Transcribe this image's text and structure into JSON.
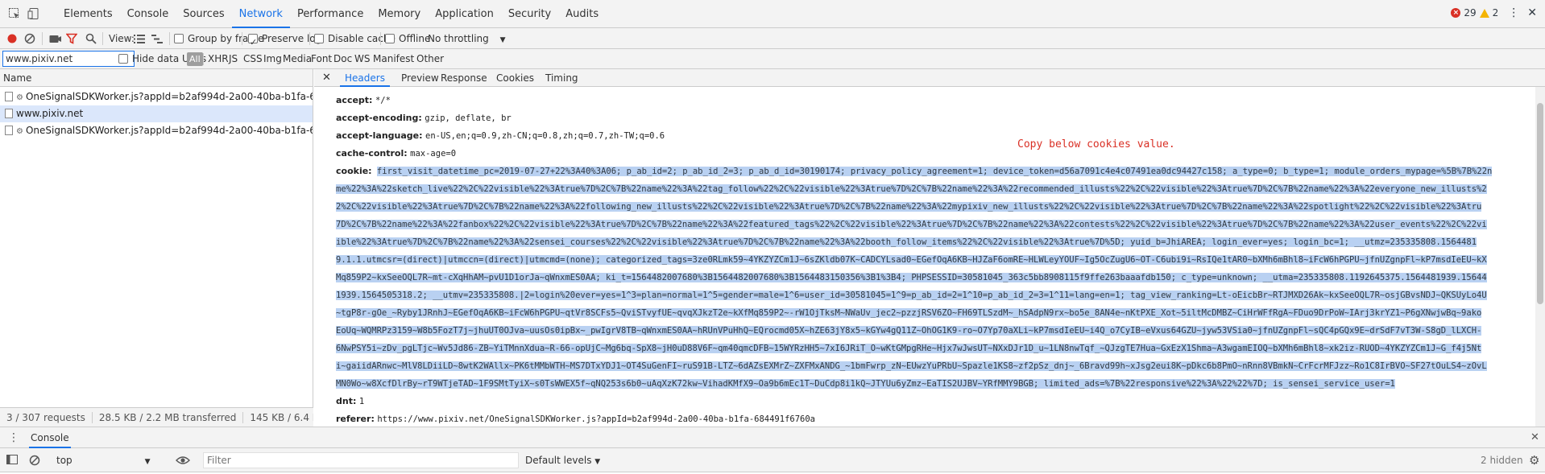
{
  "top_tabs": [
    "Elements",
    "Console",
    "Sources",
    "Network",
    "Performance",
    "Memory",
    "Application",
    "Security",
    "Audits"
  ],
  "active_top_tab": "Network",
  "issues": {
    "errors": "29",
    "warnings": "2"
  },
  "toolbar": {
    "view_label": "View:",
    "group_by_frame": "Group by frame",
    "preserve_log": "Preserve log",
    "disable_cache": "Disable cache",
    "offline": "Offline",
    "throttling": "No throttling"
  },
  "filter_bar": {
    "filter_value": "www.pixiv.net",
    "hide_data_urls": "Hide data URLs",
    "types": [
      "All",
      "XHR",
      "JS",
      "CSS",
      "Img",
      "Media",
      "Font",
      "Doc",
      "WS",
      "Manifest",
      "Other"
    ]
  },
  "request_list": {
    "header": "Name",
    "rows": [
      "OneSignalSDKWorker.js?appId=b2af994d-2a00-40ba-b1fa-6844...",
      "www.pixiv.net",
      "OneSignalSDKWorker.js?appId=b2af994d-2a00-40ba-b1fa-6844..."
    ],
    "status": [
      "3 / 307 requests",
      "28.5 KB / 2.2 MB transferred",
      "145 KB / 6.4 MB resc"
    ]
  },
  "detail_tabs": [
    "Headers",
    "Preview",
    "Response",
    "Cookies",
    "Timing"
  ],
  "active_detail_tab": "Headers",
  "headers": {
    "accept": {
      "k": "accept:",
      "v": "*/*"
    },
    "accept_encoding": {
      "k": "accept-encoding:",
      "v": "gzip, deflate, br"
    },
    "accept_language": {
      "k": "accept-language:",
      "v": "en-US,en;q=0.9,zh-CN;q=0.8,zh;q=0.7,zh-TW;q=0.6"
    },
    "cache_control": {
      "k": "cache-control:",
      "v": "max-age=0"
    },
    "cookie_key": "cookie:",
    "cookie_lines": [
      "first_visit_datetime_pc=2019-07-27+22%3A40%3A06; p_ab_id=2; p_ab_id_2=3; p_ab_d_id=30190174; privacy_policy_agreement=1; device_token=d56a7091c4e4c07491ea0dc94427c158; a_type=0; b_type=1; module_orders_mypage=%5B%7B%22n",
      "me%22%3A%22sketch_live%22%2C%22visible%22%3Atrue%7D%2C%7B%22name%22%3A%22tag_follow%22%2C%22visible%22%3Atrue%7D%2C%7B%22name%22%3A%22recommended_illusts%22%2C%22visible%22%3Atrue%7D%2C%7B%22name%22%3A%22everyone_new_illusts%2",
      "2%2C%22visible%22%3Atrue%7D%2C%7B%22name%22%3A%22following_new_illusts%22%2C%22visible%22%3Atrue%7D%2C%7B%22name%22%3A%22mypixiv_new_illusts%22%2C%22visible%22%3Atrue%7D%2C%7B%22name%22%3A%22spotlight%22%2C%22visible%22%3Atru",
      "7D%2C%7B%22name%22%3A%22fanbox%22%2C%22visible%22%3Atrue%7D%2C%7B%22name%22%3A%22featured_tags%22%2C%22visible%22%3Atrue%7D%2C%7B%22name%22%3A%22contests%22%2C%22visible%22%3Atrue%7D%2C%7B%22name%22%3A%22user_events%22%2C%22vi",
      "ible%22%3Atrue%7D%2C%7B%22name%22%3A%22sensei_courses%22%2C%22visible%22%3Atrue%7D%2C%7B%22name%22%3A%22booth_follow_items%22%2C%22visible%22%3Atrue%7D%5D; yuid_b=JhiAREA; login_ever=yes; login_bc=1; __utmz=235335808.1564481",
      "9.1.1.utmcsr=(direct)|utmccn=(direct)|utmcmd=(none); categorized_tags=3ze0RLmk59~4YKZYZCm1J~6sZKldb07K~CADCYLsad0~EGefOqA6KB~HJZaF6omRE~HLWLeyYOUF~Ig5OcZugU6~OT-C6ubi9i~RsIQe1tAR0~bXMh6mBhl8~iFcW6hPGPU~jfnUZgnpFl~kP7msdIeEU~kX",
      "Mq859P2~kxSeeOQL7R~mt-cXqHhAM~pvU1D1orJa~qWnxmES0AA; ki_t=1564482007680%3B1564482007680%3B1564483150356%3B1%3B4; PHPSESSID=30581045_363c5bb8908115f9ffe263baaafdb150; c_type=unknown; __utma=235335808.1192645375.1564481939.15644",
      "1939.1564505318.2; __utmv=235335808.|2=login%20ever=yes=1^3=plan=normal=1^5=gender=male=1^6=user_id=30581045=1^9=p_ab_id=2=1^10=p_ab_id_2=3=1^11=lang=en=1; tag_view_ranking=Lt-oEicbBr~RTJMXD26Ak~kxSeeOQL7R~osjGBvsNDJ~QKSUyLo4U",
      "~tgP8r-gOe_~Ryby1JRnhJ~EGefOqA6KB~iFcW6hPGPU~qtVr8SCFs5~QviSTvyfUE~qvqXJkzT2e~kXfMq859P2~-rW1OjTksM~NWaUv_jec2~pzzjRSV6ZO~FH69TLSzdM~_hSAdpN9rx~bo5e_8AN4e~nKtPXE_Xot~5iltMcDMBZ~CiHrWFfRgA~FDuo9DrPoW~IArj3krYZ1~P6gXNwjwBq~9ako",
      "EoUq~WQMRPz3159~W8b5FozT7j~jhuUT0OJva~uusOs0ipBx~_pwIgrV8TB~qWnxmES0AA~hRUnVPuHhQ~EQrocmd05X~hZE63jY8x5~kGYw4gQ11Z~OhOG1K9-ro~O7Yp70aXLi~kP7msdIeEU~i4Q_o7CyIB~eVxus64GZU~jyw53VSia0~jfnUZgnpFl~sQC4pGQx9E~drSdF7vT3W-S8gD_lLXCH-",
      "6NwPSY5i~zDv_pgLTjc~Wv5Jd86-ZB~YiTMnnXdua~R-66-opUjC~Mg6bq-SpX8~jH0uD88V6F~qm40qmcDFB~15WYRzHH5~7xI6JRiT_O~wKtGMpgRHe~Hjx7wJwsUT~NXxDJr1D_u~1LN8nwTqf_~QJzgTE7Hua~GxEzX1Shma~A3wgamEIOQ~bXMh6mBhl8~xk2iz-RUOD~4YKZYZCm1J~G_f4j5Nt",
      "i~gaiidARnwc~MlV8LDiiLD~8wtK2WAllx~PK6tMMbWTH~MS7DTxYDJ1~OT4SuGenFI~ruS91B-LTZ~6dAZsEXMrZ~ZXFMxANDG_~1bmFwrp_zN~EUwzYuPRbU~Spazle1KS8~zf2pSz_dnj~_6Bravd99h~xJsg2eui8K~pDkc6b8PmO~nRnn8VBmkN~CrFcrMFJzz~Ro1C8IrBVO~SF27tOuLS4~zOvL",
      "MN0Wo~w8XcfDlrBy~rT9WTjeTAD~1F9SMtTyiX~s0TsWWEX5f~qNQ253s6b0~uAqXzK72kw~VihadKMfX9~Oa9b6mEc1T~DuCdp8i1kQ~JTYUu6yZmz~EaTIS2UJBV~YRfMMY9BGB; limited_ads=%7B%22responsive%22%3A%22%22%7D; is_sensei_service_user=1"
    ],
    "dnt": {
      "k": "dnt:",
      "v": "1"
    },
    "referer": {
      "k": "referer:",
      "v": "https://www.pixiv.net/OneSignalSDKWorker.js?appId=b2af994d-2a00-40ba-b1fa-684491f6760a"
    }
  },
  "annotation": "Copy below cookies value.",
  "drawer": {
    "tab": "Console",
    "context": "top",
    "filter_placeholder": "Filter",
    "levels": "Default levels",
    "hidden": "2 hidden"
  }
}
